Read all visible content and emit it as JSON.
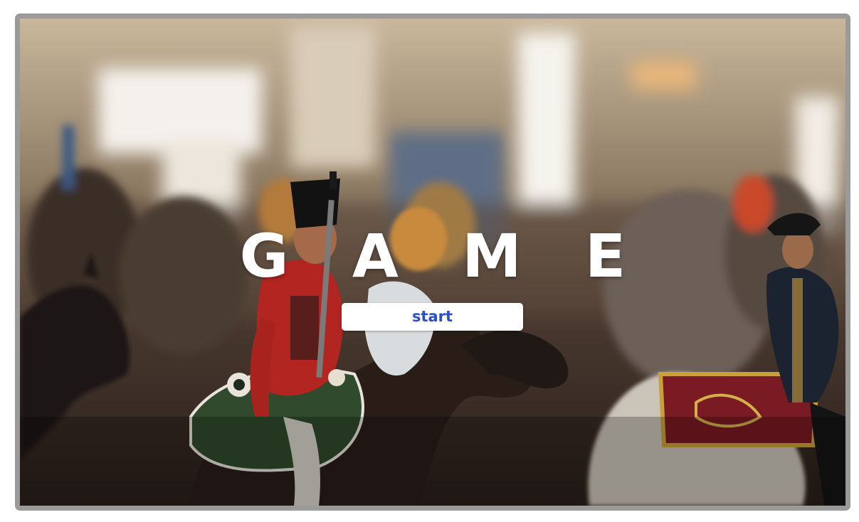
{
  "game": {
    "title": "G A M E",
    "start_label": "start"
  },
  "colors": {
    "frame_border": "#9a9a9a",
    "title": "#ffffff",
    "button_bg": "#ffffff",
    "button_text": "#2a4fc9"
  },
  "background": {
    "description_icon": "toy-soldiers-cavalry-photo"
  }
}
